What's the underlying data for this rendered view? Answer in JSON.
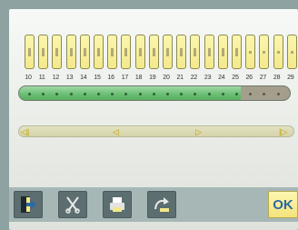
{
  "timer": {
    "hour_labels": [
      "10",
      "11",
      "12",
      "13",
      "14",
      "15",
      "16",
      "17",
      "18",
      "19",
      "20",
      "21",
      "22",
      "23",
      "24",
      "25",
      "26",
      "27",
      "28",
      "29"
    ],
    "active_hours_fraction": 0.82
  },
  "toolbar": {
    "buttons": [
      "exit-door-icon",
      "scissors-icon",
      "printer-icon",
      "redo-arrow-icon"
    ],
    "ok_label": "OK"
  },
  "colors": {
    "accent_green": "#69bd72",
    "tick_yellow": "#f3e98a",
    "ok_text": "#2a6aa3",
    "toolbar_bg": "#a6b7b6"
  }
}
